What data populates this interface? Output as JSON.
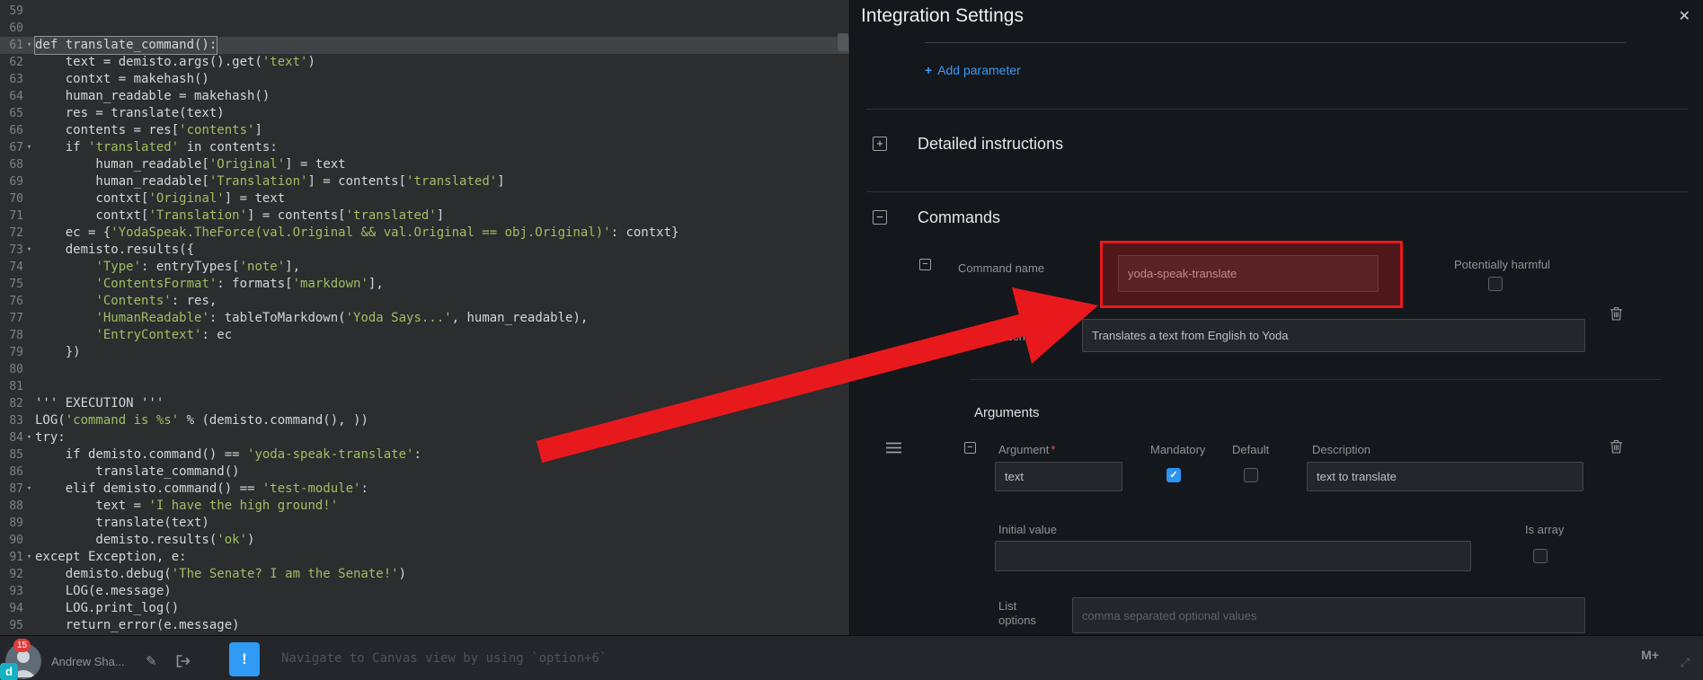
{
  "colors": {
    "accent_blue": "#3a9af7",
    "annotation_red": "#e8191c",
    "checked_blue": "#2e93f0"
  },
  "icons": {
    "close": "✕",
    "plus": "+",
    "minus": "−",
    "fold": "▾",
    "check": "✓",
    "warning": "!",
    "markdown": "M+",
    "expand": "⤢",
    "pencil": "✎"
  },
  "editor": {
    "lines": [
      {
        "n": "59",
        "fold": false,
        "hl": false,
        "segs": []
      },
      {
        "n": "60",
        "fold": false,
        "hl": false,
        "segs": []
      },
      {
        "n": "61",
        "fold": true,
        "hl": true,
        "segs": [
          [
            "p",
            "def translate_command():"
          ]
        ]
      },
      {
        "n": "62",
        "fold": false,
        "hl": false,
        "segs": [
          [
            "p",
            "    text = demisto.args().get("
          ],
          [
            "s",
            "'text'"
          ],
          [
            "p",
            ")"
          ]
        ]
      },
      {
        "n": "63",
        "fold": false,
        "hl": false,
        "segs": [
          [
            "p",
            "    contxt = makehash()"
          ]
        ]
      },
      {
        "n": "64",
        "fold": false,
        "hl": false,
        "segs": [
          [
            "p",
            "    human_readable = makehash()"
          ]
        ]
      },
      {
        "n": "65",
        "fold": false,
        "hl": false,
        "segs": [
          [
            "p",
            "    res = translate(text)"
          ]
        ]
      },
      {
        "n": "66",
        "fold": false,
        "hl": false,
        "segs": [
          [
            "p",
            "    contents = res["
          ],
          [
            "s",
            "'contents'"
          ],
          [
            "p",
            "]"
          ]
        ]
      },
      {
        "n": "67",
        "fold": true,
        "hl": false,
        "segs": [
          [
            "p",
            "    if "
          ],
          [
            "s",
            "'translated'"
          ],
          [
            "p",
            " in contents:"
          ]
        ]
      },
      {
        "n": "68",
        "fold": false,
        "hl": false,
        "segs": [
          [
            "p",
            "        human_readable["
          ],
          [
            "s",
            "'Original'"
          ],
          [
            "p",
            "] = text"
          ]
        ]
      },
      {
        "n": "69",
        "fold": false,
        "hl": false,
        "segs": [
          [
            "p",
            "        human_readable["
          ],
          [
            "s",
            "'Translation'"
          ],
          [
            "p",
            "] = contents["
          ],
          [
            "s",
            "'translated'"
          ],
          [
            "p",
            "]"
          ]
        ]
      },
      {
        "n": "70",
        "fold": false,
        "hl": false,
        "segs": [
          [
            "p",
            "        contxt["
          ],
          [
            "s",
            "'Original'"
          ],
          [
            "p",
            "] = text"
          ]
        ]
      },
      {
        "n": "71",
        "fold": false,
        "hl": false,
        "segs": [
          [
            "p",
            "        contxt["
          ],
          [
            "s",
            "'Translation'"
          ],
          [
            "p",
            "] = contents["
          ],
          [
            "s",
            "'translated'"
          ],
          [
            "p",
            "]"
          ]
        ]
      },
      {
        "n": "72",
        "fold": false,
        "hl": false,
        "segs": [
          [
            "p",
            "    ec = {"
          ],
          [
            "s",
            "'YodaSpeak.TheForce(val.Original && val.Original == obj.Original)'"
          ],
          [
            "p",
            ": contxt}"
          ]
        ]
      },
      {
        "n": "73",
        "fold": true,
        "hl": false,
        "segs": [
          [
            "p",
            "    demisto.results({"
          ]
        ]
      },
      {
        "n": "74",
        "fold": false,
        "hl": false,
        "segs": [
          [
            "p",
            "        "
          ],
          [
            "s",
            "'Type'"
          ],
          [
            "p",
            ": entryTypes["
          ],
          [
            "s",
            "'note'"
          ],
          [
            "p",
            "],"
          ]
        ]
      },
      {
        "n": "75",
        "fold": false,
        "hl": false,
        "segs": [
          [
            "p",
            "        "
          ],
          [
            "s",
            "'ContentsFormat'"
          ],
          [
            "p",
            ": formats["
          ],
          [
            "s",
            "'markdown'"
          ],
          [
            "p",
            "],"
          ]
        ]
      },
      {
        "n": "76",
        "fold": false,
        "hl": false,
        "segs": [
          [
            "p",
            "        "
          ],
          [
            "s",
            "'Contents'"
          ],
          [
            "p",
            ": res,"
          ]
        ]
      },
      {
        "n": "77",
        "fold": false,
        "hl": false,
        "segs": [
          [
            "p",
            "        "
          ],
          [
            "s",
            "'HumanReadable'"
          ],
          [
            "p",
            ": tableToMarkdown("
          ],
          [
            "s",
            "'Yoda Says...'"
          ],
          [
            "p",
            ", human_readable),"
          ]
        ]
      },
      {
        "n": "78",
        "fold": false,
        "hl": false,
        "segs": [
          [
            "p",
            "        "
          ],
          [
            "s",
            "'EntryContext'"
          ],
          [
            "p",
            ": ec"
          ]
        ]
      },
      {
        "n": "79",
        "fold": false,
        "hl": false,
        "segs": [
          [
            "p",
            "    })"
          ]
        ]
      },
      {
        "n": "80",
        "fold": false,
        "hl": false,
        "segs": []
      },
      {
        "n": "81",
        "fold": false,
        "hl": false,
        "segs": []
      },
      {
        "n": "82",
        "fold": false,
        "hl": false,
        "segs": [
          [
            "p",
            "''' EXECUTION '''"
          ]
        ]
      },
      {
        "n": "83",
        "fold": false,
        "hl": false,
        "segs": [
          [
            "p",
            "LOG("
          ],
          [
            "s",
            "'command is %s'"
          ],
          [
            "p",
            " % (demisto.command(), ))"
          ]
        ]
      },
      {
        "n": "84",
        "fold": true,
        "hl": false,
        "segs": [
          [
            "p",
            "try:"
          ]
        ]
      },
      {
        "n": "85",
        "fold": false,
        "hl": false,
        "segs": [
          [
            "p",
            "    if demisto.command() == "
          ],
          [
            "s",
            "'yoda-speak-translate'"
          ],
          [
            "p",
            ":"
          ]
        ]
      },
      {
        "n": "86",
        "fold": false,
        "hl": false,
        "segs": [
          [
            "p",
            "        translate_command()"
          ]
        ]
      },
      {
        "n": "87",
        "fold": true,
        "hl": false,
        "segs": [
          [
            "p",
            "    elif demisto.command() == "
          ],
          [
            "s",
            "'test-module'"
          ],
          [
            "p",
            ":"
          ]
        ]
      },
      {
        "n": "88",
        "fold": false,
        "hl": false,
        "segs": [
          [
            "p",
            "        text = "
          ],
          [
            "s",
            "'I have the high ground!'"
          ]
        ]
      },
      {
        "n": "89",
        "fold": false,
        "hl": false,
        "segs": [
          [
            "p",
            "        translate(text)"
          ]
        ]
      },
      {
        "n": "90",
        "fold": false,
        "hl": false,
        "segs": [
          [
            "p",
            "        demisto.results("
          ],
          [
            "s",
            "'ok'"
          ],
          [
            "p",
            ")"
          ]
        ]
      },
      {
        "n": "91",
        "fold": true,
        "hl": false,
        "segs": [
          [
            "p",
            "except Exception, e:"
          ]
        ]
      },
      {
        "n": "92",
        "fold": false,
        "hl": false,
        "segs": [
          [
            "p",
            "    demisto.debug("
          ],
          [
            "s",
            "'The Senate? I am the Senate!'"
          ],
          [
            "p",
            ")"
          ]
        ]
      },
      {
        "n": "93",
        "fold": false,
        "hl": false,
        "segs": [
          [
            "p",
            "    LOG(e.message)"
          ]
        ]
      },
      {
        "n": "94",
        "fold": false,
        "hl": false,
        "segs": [
          [
            "p",
            "    LOG.print_log()"
          ]
        ]
      },
      {
        "n": "95",
        "fold": false,
        "hl": false,
        "segs": [
          [
            "p",
            "    return_error(e.message)"
          ]
        ]
      }
    ]
  },
  "panel": {
    "title": "Integration Settings",
    "add_parameter_label": "Add parameter",
    "sections": {
      "detailed_instructions": "Detailed instructions",
      "commands": "Commands",
      "arguments": "Arguments"
    },
    "command": {
      "name_label": "Command name",
      "name_value": "yoda-speak-translate",
      "potentially_harmful_label": "Potentially harmful",
      "description_label": "Description",
      "description_value": "Translates a text from English to Yoda"
    },
    "argument": {
      "label": "Argument",
      "required_mark": "*",
      "name_value": "text",
      "mandatory_label": "Mandatory",
      "default_label": "Default",
      "description_label": "Description",
      "description_value": "text to translate",
      "initial_value_label": "Initial value",
      "is_array_label": "Is array",
      "list_options_label": "List options",
      "list_options_placeholder": "comma separated optional values"
    }
  },
  "bottom_bar": {
    "user_name": "Andrew Sha...",
    "badge_count": "15",
    "cli_placeholder": "Navigate to Canvas view by using `option+6`"
  }
}
